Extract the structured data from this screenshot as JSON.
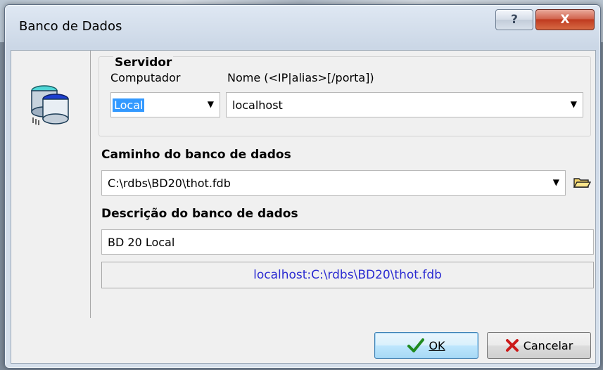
{
  "window": {
    "title": "Banco de Dados"
  },
  "titlebar": {
    "help_glyph": "?",
    "close_glyph": "X"
  },
  "server_group": {
    "title": "Servidor",
    "computer_label": "Computador",
    "computer_value": "Local",
    "name_label": "Nome (<IP|alias>[/porta])",
    "name_value": "localhost"
  },
  "path": {
    "label": "Caminho do banco de dados",
    "value": "C:\\rdbs\\BD20\\thot.fdb"
  },
  "description": {
    "label": "Descrição do banco de dados",
    "value": "BD 20 Local"
  },
  "summary_text": "localhost:C:\\rdbs\\BD20\\thot.fdb",
  "buttons": {
    "ok": "OK",
    "cancel": "Cancelar"
  },
  "icons": {
    "database": "database-icon",
    "folder": "folder-open-icon",
    "check": "checkmark-icon",
    "cancel": "x-icon"
  }
}
